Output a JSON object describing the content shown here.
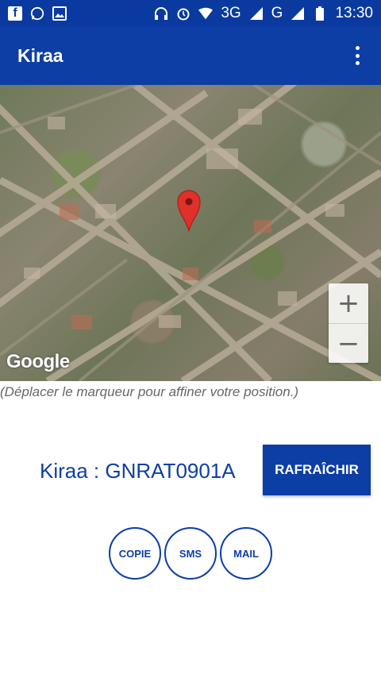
{
  "status_bar": {
    "left_icons": [
      "facebook-icon",
      "whatsapp-icon",
      "gallery-icon"
    ],
    "network_labels": [
      "3G",
      "G"
    ],
    "time": "13:30"
  },
  "app_bar": {
    "title": "Kiraa"
  },
  "map": {
    "provider_logo": "Google",
    "zoom_in_label": "+",
    "zoom_out_label": "−",
    "marker_color": "#e0302a"
  },
  "hint": "(Déplacer le marqueur pour affiner votre position.)",
  "code": {
    "text": "Kiraa : GNRAT0901A",
    "refresh_label": "RAFRAÎCHIR"
  },
  "share": {
    "copy_label": "COPIE",
    "sms_label": "SMS",
    "mail_label": "MAIL"
  },
  "colors": {
    "primary": "#0d3ea6",
    "status_bar": "#0a3aa0"
  }
}
